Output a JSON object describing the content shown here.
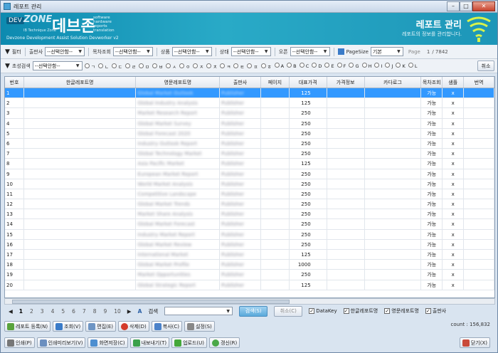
{
  "window": {
    "title": "레포트 관리",
    "min": "–",
    "max": "□",
    "close": "✕"
  },
  "banner": {
    "logo_dev": "DEV",
    "logo_zone": "ZONE",
    "logo_sub": "IB Technique Zone",
    "brand": "데브존",
    "tagline": "software hardware reports translation",
    "dev_title": "Devzone Development Assist Solution Devworker v2",
    "right_title": "레포트 관리",
    "right_sub": "레포트의 정보를 관리합니다."
  },
  "filter1": {
    "filter_label": "필터",
    "publisher_label": "출판사",
    "publisher_value": "--선택안함--",
    "toc_label": "목차조회",
    "toc_value": "--선택안함--",
    "product_label": "상품",
    "product_value": "--선택안함--",
    "status_label": "상태",
    "status_value": "--선택안함--",
    "open_label": "오픈",
    "open_value": "--선택안함--",
    "pagesize_label": "PageSize",
    "pagesize_value": "기본",
    "page_label": "Page",
    "page_current": "1",
    "page_total": "/ 7842"
  },
  "filter2": {
    "initial_label": "초성검색",
    "initial_value": "--선택안함--",
    "consonants": [
      "ㄱ",
      "ㄴ",
      "ㄷ",
      "ㄹ",
      "ㅁ",
      "ㅂ",
      "ㅅ",
      "ㅇ",
      "ㅈ",
      "ㅊ",
      "ㅋ",
      "ㅌ",
      "ㅍ",
      "ㅎ"
    ],
    "letters": [
      "A",
      "B",
      "C",
      "D",
      "E",
      "F",
      "G",
      "H",
      "I",
      "J",
      "K",
      "L"
    ],
    "cancel": "취소"
  },
  "grid": {
    "headers": [
      "번호",
      "한글레포트명",
      "영문레포트명",
      "출판사",
      "페이지",
      "대표가격",
      "가격정보",
      "카다로그",
      "목차조회",
      "샘플",
      "번역"
    ],
    "rows": [
      {
        "no": "1",
        "en": "Global Market Outlook",
        "pub": "Publisher",
        "price": "125",
        "toc": "가능",
        "sample": "x"
      },
      {
        "no": "2",
        "en": "Global Industry Analysis",
        "pub": "Publisher",
        "price": "125",
        "toc": "가능",
        "sample": "x"
      },
      {
        "no": "3",
        "en": "Market Research Report",
        "pub": "Publisher",
        "price": "250",
        "toc": "가능",
        "sample": "x"
      },
      {
        "no": "4",
        "en": "Global Market Survey",
        "pub": "Publisher",
        "price": "250",
        "toc": "가능",
        "sample": "x"
      },
      {
        "no": "5",
        "en": "Global Forecast 2020",
        "pub": "Publisher",
        "price": "250",
        "toc": "가능",
        "sample": "x"
      },
      {
        "no": "6",
        "en": "Industry Outlook Report",
        "pub": "Publisher",
        "price": "250",
        "toc": "가능",
        "sample": "x"
      },
      {
        "no": "7",
        "en": "Global Technology Market",
        "pub": "Publisher",
        "price": "250",
        "toc": "가능",
        "sample": "x"
      },
      {
        "no": "8",
        "en": "Asia Pacific Market",
        "pub": "Publisher",
        "price": "125",
        "toc": "가능",
        "sample": "x"
      },
      {
        "no": "9",
        "en": "European Market Report",
        "pub": "Publisher",
        "price": "250",
        "toc": "가능",
        "sample": "x"
      },
      {
        "no": "10",
        "en": "World Market Analysis",
        "pub": "Publisher",
        "price": "250",
        "toc": "가능",
        "sample": "x"
      },
      {
        "no": "11",
        "en": "Competitive Landscape",
        "pub": "Publisher",
        "price": "250",
        "toc": "가능",
        "sample": "x"
      },
      {
        "no": "12",
        "en": "Global Market Trends",
        "pub": "Publisher",
        "price": "250",
        "toc": "가능",
        "sample": "x"
      },
      {
        "no": "13",
        "en": "Market Share Analysis",
        "pub": "Publisher",
        "price": "250",
        "toc": "가능",
        "sample": "x"
      },
      {
        "no": "14",
        "en": "Global Market Forecast",
        "pub": "Publisher",
        "price": "250",
        "toc": "가능",
        "sample": "x"
      },
      {
        "no": "15",
        "en": "Industry Market Report",
        "pub": "Publisher",
        "price": "250",
        "toc": "가능",
        "sample": "x"
      },
      {
        "no": "16",
        "en": "Global Market Review",
        "pub": "Publisher",
        "price": "250",
        "toc": "가능",
        "sample": "x"
      },
      {
        "no": "17",
        "en": "International Market",
        "pub": "Publisher",
        "price": "125",
        "toc": "가능",
        "sample": "x"
      },
      {
        "no": "18",
        "en": "Global Market Profile",
        "pub": "Publisher",
        "price": "1000",
        "toc": "가능",
        "sample": "x"
      },
      {
        "no": "19",
        "en": "Market Opportunities",
        "pub": "Publisher",
        "price": "250",
        "toc": "가능",
        "sample": "x"
      },
      {
        "no": "20",
        "en": "Global Strategic Report",
        "pub": "Publisher",
        "price": "125",
        "toc": "가능",
        "sample": "x"
      }
    ]
  },
  "pager": {
    "pages": [
      "1",
      "2",
      "3",
      "4",
      "5",
      "6",
      "7",
      "8",
      "9",
      "10"
    ],
    "next": "▶",
    "prev": "◀",
    "search_label": "검색",
    "search_btn": "검색(S)",
    "cancel_btn": "취소(C)",
    "chk_datakey": "DataKey",
    "chk_kor": "한글레포트명",
    "chk_eng": "영문레포트명",
    "chk_pub": "출판사"
  },
  "actions": {
    "register": "레포트 등록(N)",
    "view": "조회(V)",
    "edit": "편집(E)",
    "delete": "삭제(D)",
    "copy": "복사(C)",
    "settings": "설정(S)"
  },
  "actions2": {
    "print": "인쇄(P)",
    "preview": "인쇄미리보기(V)",
    "save_screen": "화면저장(C)",
    "export": "내보내기(T)",
    "upload": "업로드(U)",
    "refresh": "갱신(R)",
    "close": "닫기(X)"
  },
  "count": "count : 156,832"
}
